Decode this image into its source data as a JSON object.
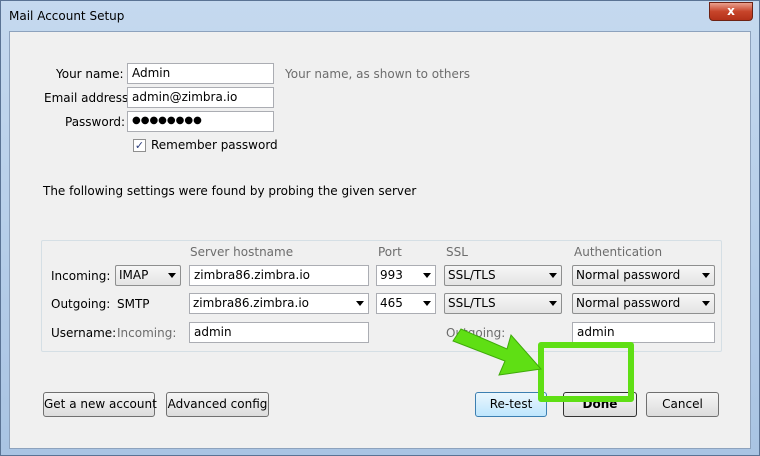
{
  "window": {
    "title": "Mail Account Setup",
    "close_glyph": "x"
  },
  "form": {
    "name_label": "Your name:",
    "name_value": "Admin",
    "name_hint": "Your name, as shown to others",
    "email_label": "Email address:",
    "email_value": "admin@zimbra.io",
    "password_label": "Password:",
    "password_value": "●●●●●●●●",
    "remember_label": "Remember password",
    "remember_checked": true
  },
  "probe_message": "The following settings were found by probing the given server",
  "server_table": {
    "headers": {
      "hostname": "Server hostname",
      "port": "Port",
      "ssl": "SSL",
      "auth": "Authentication"
    },
    "incoming": {
      "label": "Incoming:",
      "protocol": "IMAP",
      "hostname": "zimbra86.zimbra.io",
      "port": "993",
      "ssl": "SSL/TLS",
      "auth": "Normal password"
    },
    "outgoing": {
      "label": "Outgoing:",
      "protocol": "SMTP",
      "hostname": "zimbra86.zimbra.io",
      "port": "465",
      "ssl": "SSL/TLS",
      "auth": "Normal password"
    },
    "username": {
      "label": "Username:",
      "incoming_label": "Incoming:",
      "incoming_value": "admin",
      "outgoing_label": "Outgoing:",
      "outgoing_value": "admin"
    }
  },
  "buttons": {
    "new_account": "Get a new account",
    "advanced": "Advanced config",
    "retest": "Re-test",
    "done": "Done",
    "cancel": "Cancel"
  },
  "colors": {
    "highlight": "#5fdf14",
    "arrow": "#5fdf14"
  }
}
